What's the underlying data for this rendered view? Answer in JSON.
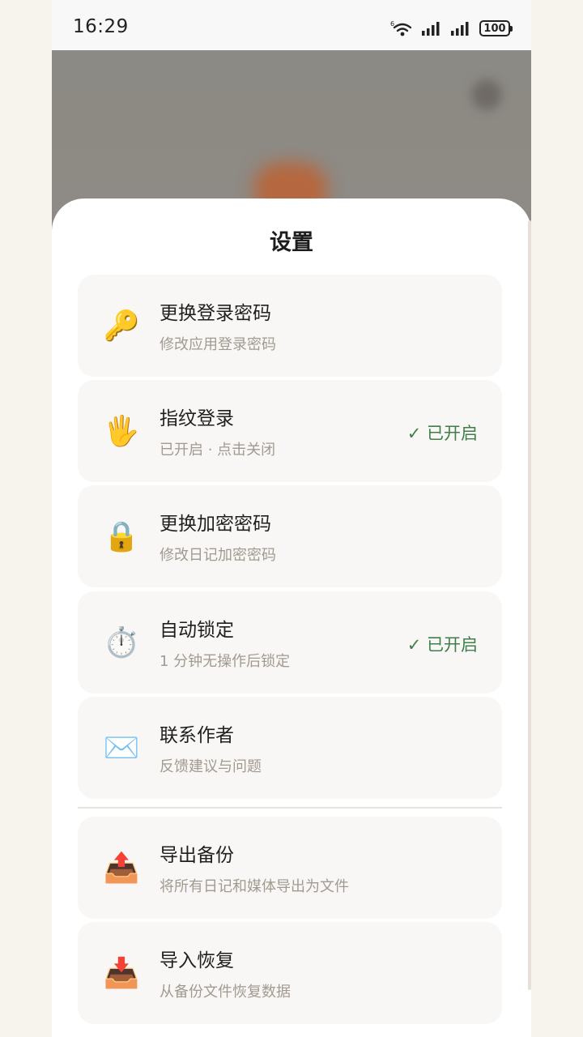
{
  "status_bar": {
    "time": "16:29",
    "battery": "100"
  },
  "sheet": {
    "title": "设置"
  },
  "settings": [
    {
      "title": "更换登录密码",
      "subtitle": "修改应用登录密码",
      "icon": "key-icon",
      "glyph": "🔑",
      "status": ""
    },
    {
      "title": "指纹登录",
      "subtitle": "已开启 · 点击关闭",
      "icon": "hand-icon",
      "glyph": "🖐️",
      "status": "✓ 已开启"
    },
    {
      "title": "更换加密密码",
      "subtitle": "修改日记加密密码",
      "icon": "lock-icon",
      "glyph": "🔒",
      "status": ""
    },
    {
      "title": "自动锁定",
      "subtitle": "1 分钟无操作后锁定",
      "icon": "stopwatch-icon",
      "glyph": "⏱️",
      "status": "✓ 已开启"
    },
    {
      "title": "联系作者",
      "subtitle": "反馈建议与问题",
      "icon": "envelope-icon",
      "glyph": "✉️",
      "status": ""
    },
    {
      "title": "导出备份",
      "subtitle": "将所有日记和媒体导出为文件",
      "icon": "outbox-tray-icon",
      "glyph": "📤",
      "status": ""
    },
    {
      "title": "导入恢复",
      "subtitle": "从备份文件恢复数据",
      "icon": "inbox-tray-icon",
      "glyph": "📥",
      "status": ""
    }
  ],
  "colors": {
    "accent_green": "#3e7e49",
    "card_bg": "#f8f7f5",
    "page_bg": "#f7f4ee"
  }
}
